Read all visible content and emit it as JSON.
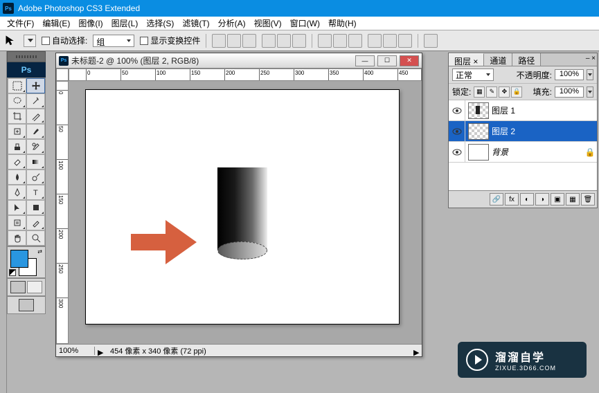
{
  "app": {
    "title": "Adobe Photoshop CS3 Extended",
    "icon_label": "Ps"
  },
  "menus": [
    "文件(F)",
    "编辑(E)",
    "图像(I)",
    "图层(L)",
    "选择(S)",
    "滤镜(T)",
    "分析(A)",
    "视图(V)",
    "窗口(W)",
    "帮助(H)"
  ],
  "options": {
    "auto_select_label": "自动选择:",
    "group_label": "组",
    "show_transform_label": "显示变换控件"
  },
  "document": {
    "title": "未标题-2 @ 100% (图层 2, RGB/8)",
    "ruler_h": [
      "0",
      "50",
      "100",
      "150",
      "200",
      "250",
      "300",
      "350",
      "400",
      "450"
    ],
    "ruler_v": [
      "0",
      "50",
      "100",
      "150",
      "200",
      "250",
      "300"
    ],
    "zoom": "100%",
    "status": "454 像素 x 340 像素 (72 ppi)"
  },
  "layers_panel": {
    "tabs": [
      "图层 ×",
      "通道",
      "路径"
    ],
    "blend_mode": "正常",
    "opacity_label": "不透明度:",
    "opacity_value": "100%",
    "lock_label": "锁定:",
    "fill_label": "填充:",
    "fill_value": "100%",
    "layers": [
      {
        "name": "图层 1",
        "selected": false,
        "thumb": "checker-cyl",
        "locked": false,
        "bg": false
      },
      {
        "name": "图层 2",
        "selected": true,
        "thumb": "checker",
        "locked": false,
        "bg": false
      },
      {
        "name": "背景",
        "selected": false,
        "thumb": "white",
        "locked": true,
        "bg": true
      }
    ]
  },
  "watermark": {
    "cn": "溜溜自学",
    "url": "ZIXUE.3D66.COM"
  }
}
